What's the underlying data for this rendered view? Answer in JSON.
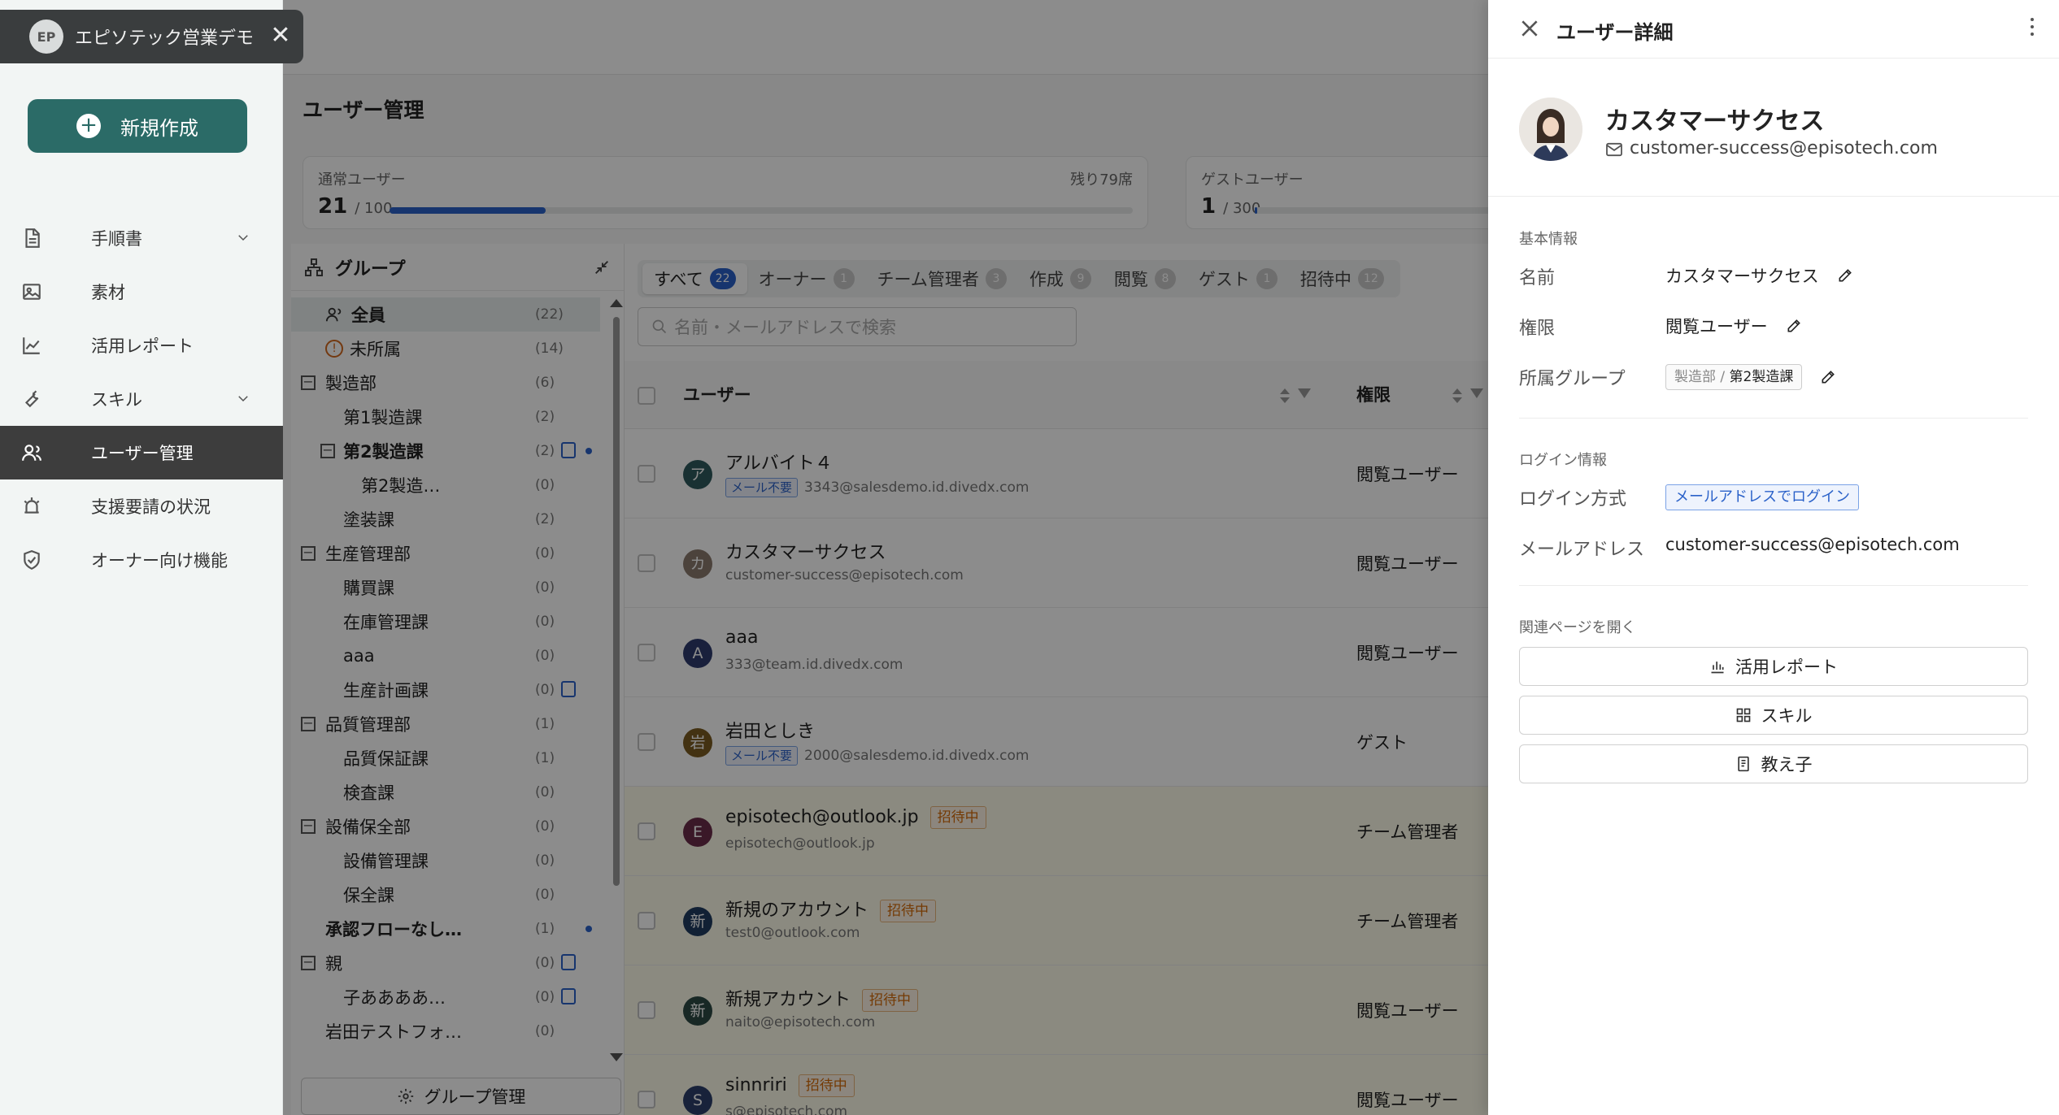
{
  "workspace": {
    "name": "エピソテック営業デモ",
    "logo_text": "EP"
  },
  "new_button": "新規作成",
  "nav": [
    {
      "label": "手順書",
      "icon": "document-icon",
      "has_chevron": true,
      "active": false
    },
    {
      "label": "素材",
      "icon": "image-icon",
      "has_chevron": false,
      "active": false
    },
    {
      "label": "活用レポート",
      "icon": "chart-line-icon",
      "has_chevron": false,
      "active": false
    },
    {
      "label": "スキル",
      "icon": "wrench-icon",
      "has_chevron": true,
      "active": false
    },
    {
      "label": "ユーザー管理",
      "icon": "users-icon",
      "has_chevron": false,
      "active": true
    },
    {
      "label": "支援要請の状況",
      "icon": "alarm-icon",
      "has_chevron": false,
      "active": false
    },
    {
      "label": "オーナー向け機能",
      "icon": "shield-check-icon",
      "has_chevron": false,
      "active": false
    }
  ],
  "page_title": "ユーザー管理",
  "quota": {
    "regular": {
      "label": "通常ユーザー",
      "used": "21",
      "total": "/ 100",
      "remaining": "残り79席",
      "progress": 0.21
    },
    "guest": {
      "label": "ゲストユーザー",
      "used": "1",
      "total": "/ 300",
      "progress": 0.003
    }
  },
  "groups": {
    "title": "グループ",
    "manage_label": "グループ管理",
    "tree": [
      {
        "label": "全員",
        "count": "(22)",
        "level": 0,
        "kind": "all",
        "selected": true,
        "bold": true
      },
      {
        "label": "未所属",
        "count": "(14)",
        "level": 0,
        "kind": "warn"
      },
      {
        "label": "製造部",
        "count": "(6)",
        "level": 0,
        "kind": "box"
      },
      {
        "label": "第1製造課",
        "count": "(2)",
        "level": 1
      },
      {
        "label": "第2製造課",
        "count": "(2)",
        "level": 1,
        "kind": "box",
        "bold": true,
        "mark": true,
        "dot": true
      },
      {
        "label": "第2製造…",
        "count": "(0)",
        "level": 2
      },
      {
        "label": "塗装課",
        "count": "(2)",
        "level": 1
      },
      {
        "label": "生産管理部",
        "count": "(0)",
        "level": 0,
        "kind": "box"
      },
      {
        "label": "購買課",
        "count": "(0)",
        "level": 1
      },
      {
        "label": "在庫管理課",
        "count": "(0)",
        "level": 1
      },
      {
        "label": "aaa",
        "count": "(0)",
        "level": 1
      },
      {
        "label": "生産計画課",
        "count": "(0)",
        "level": 1,
        "mark": true
      },
      {
        "label": "品質管理部",
        "count": "(1)",
        "level": 0,
        "kind": "box"
      },
      {
        "label": "品質保証課",
        "count": "(1)",
        "level": 1
      },
      {
        "label": "検査課",
        "count": "(0)",
        "level": 1
      },
      {
        "label": "設備保全部",
        "count": "(0)",
        "level": 0,
        "kind": "box"
      },
      {
        "label": "設備管理課",
        "count": "(0)",
        "level": 1
      },
      {
        "label": "保全課",
        "count": "(0)",
        "level": 1
      },
      {
        "label": "承認フローなし…",
        "count": "(1)",
        "level": 0,
        "bold": true,
        "dot": true
      },
      {
        "label": "親",
        "count": "(0)",
        "level": 0,
        "kind": "box",
        "mark": true
      },
      {
        "label": "子ああああ…",
        "count": "(0)",
        "level": 1,
        "mark": true
      },
      {
        "label": "岩田テストフォ…",
        "count": "(0)",
        "level": 0
      }
    ]
  },
  "tabs": [
    {
      "label": "すべて",
      "count": "22",
      "active": true
    },
    {
      "label": "オーナー",
      "count": "1"
    },
    {
      "label": "チーム管理者",
      "count": "3"
    },
    {
      "label": "作成",
      "count": "9"
    },
    {
      "label": "閲覧",
      "count": "8"
    },
    {
      "label": "ゲスト",
      "count": "1"
    },
    {
      "label": "招待中",
      "count": "12"
    }
  ],
  "search_placeholder": "名前・メールアドレスで検索",
  "table": {
    "col_user": "ユーザー",
    "col_role": "権限",
    "rows": [
      {
        "initial": "ア",
        "color": "#2f5a5e",
        "name": "アルバイト４",
        "tag": "メール不要",
        "email": "3343@salesdemo.id.divedx.com",
        "role": "閲覧ユーザー",
        "invited": false
      },
      {
        "initial": "カ",
        "color": "#8a7a6e",
        "name": "カスタマーサクセス",
        "tag": "",
        "email": "customer-success@episotech.com",
        "role": "閲覧ユーザー",
        "invited": false
      },
      {
        "initial": "A",
        "color": "#2e3b6e",
        "name": "aaa",
        "tag": "",
        "email": "333@team.id.divedx.com",
        "role": "閲覧ユーザー",
        "invited": false
      },
      {
        "initial": "岩",
        "color": "#7b5b22",
        "name": "岩田としき",
        "tag": "メール不要",
        "email": "2000@salesdemo.id.divedx.com",
        "role": "ゲスト",
        "invited": false
      },
      {
        "initial": "E",
        "color": "#6a2c4a",
        "name": "episotech@outlook.jp",
        "tag": "",
        "email": "episotech@outlook.jp",
        "role": "チーム管理者",
        "invited": true
      },
      {
        "initial": "新",
        "color": "#1f3b60",
        "name": "新規のアカウント",
        "tag": "",
        "email": "test0@outlook.com",
        "role": "チーム管理者",
        "invited": true
      },
      {
        "initial": "新",
        "color": "#2d4a44",
        "name": "新規アカウント",
        "tag": "",
        "email": "naito@episotech.com",
        "role": "閲覧ユーザー",
        "invited": true
      },
      {
        "initial": "S",
        "color": "#2c3f6b",
        "name": "sinnriri",
        "tag": "",
        "email": "s@episotech.com",
        "role": "閲覧ユーザー",
        "invited": true
      }
    ],
    "invited_label": "招待中"
  },
  "drawer": {
    "title": "ユーザー詳細",
    "name": "カスタマーサクセス",
    "email": "customer-success@episotech.com",
    "basic_title": "基本情報",
    "name_key": "名前",
    "name_value": "カスタマーサクセス",
    "role_key": "権限",
    "role_value": "閲覧ユーザー",
    "group_key": "所属グループ",
    "group_parent": "製造部 /",
    "group_child": "第2製造課",
    "login_title": "ログイン情報",
    "login_method_key": "ログイン方式",
    "login_method_value": "メールアドレスでログイン",
    "login_mail_key": "メールアドレス",
    "login_mail_value": "customer-success@episotech.com",
    "related_title": "関連ページを開く",
    "buttons": [
      {
        "label": "活用レポート",
        "icon": "bar-chart-icon"
      },
      {
        "label": "スキル",
        "icon": "grid-icon"
      },
      {
        "label": "教え子",
        "icon": "notebook-icon"
      }
    ]
  },
  "colors": {
    "accent": "#2b62c9",
    "brand": "#2b6b67",
    "invited_bg": "#fdfbea",
    "invited_tag": "#d46b08"
  }
}
